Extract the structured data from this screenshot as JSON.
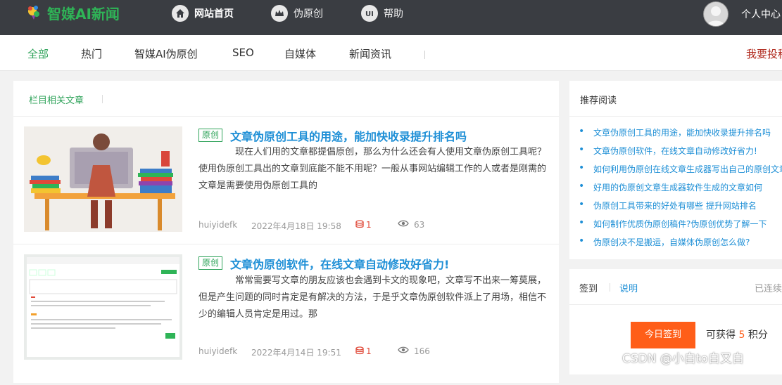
{
  "brand": {
    "name": "智媒AI新闻",
    "accent": "#2fb457"
  },
  "topnav": {
    "home": {
      "label": "网站首页",
      "icon": "home-icon"
    },
    "rewrite": {
      "label": "伪原创",
      "icon": "crown-icon"
    },
    "help": {
      "label": "帮助",
      "icon": "ui-icon"
    },
    "user": {
      "label": "个人中心"
    }
  },
  "categories": [
    "全部",
    "热门",
    "智媒AI伪原创",
    "SEO",
    "自媒体",
    "新闻资讯"
  ],
  "submit_link": "我要投稿",
  "main": {
    "heading": "栏目相关文章",
    "articles": [
      {
        "badge": "原创",
        "title": "文章伪原创工具的用途，能加快收录提升排名吗",
        "desc": "　　　　现在人们用的文章都提倡原创，那么为什么还会有人使用文章伪原创工具呢？使用伪原创工具出的文章到底能不能不用呢？一般从事网站编辑工作的人或者是刚需的文章是需要使用伪原创工具的",
        "author": "huiyidefk",
        "date": "2022年4月18日 19:58",
        "comments": "1",
        "views": "63"
      },
      {
        "badge": "原创",
        "title": "文章伪原创软件，在线文章自动修改好省力!",
        "desc": "　　　　常常需要写文章的朋友应该也会遇到卡文的现象吧，文章写不出来一筹莫展，但是产生问题的同时肯定是有解决的方法，于是乎文章伪原创软件派上了用场，相信不少的编辑人员肯定是用过。那",
        "author": "huiyidefk",
        "date": "2022年4月14日 19:51",
        "comments": "1",
        "views": "166"
      }
    ]
  },
  "sidebar": {
    "recommend_title": "推荐阅读",
    "recommend": [
      "文章伪原创工具的用途，能加快收录提升排名吗",
      "文章伪原创软件，在线文章自动修改好省力!",
      "如何利用伪原创在线文章生成器写出自己的原创文章",
      "好用的伪原创文章生成器软件生成的文章如何",
      "伪原创工具带来的好处有哪些 提升网站排名",
      "如何制作优质伪原创稿件?伪原创优势了解一下",
      "伪原创决不是搬运，自媒体伪原创怎么做?"
    ],
    "signin": {
      "label": "签到",
      "explain": "说明",
      "streak": "已连续签到",
      "button": "今日签到",
      "points_prefix": "可获得",
      "points_value": "5",
      "points_suffix": "积分"
    }
  },
  "watermark": "CSDN @小白to白又白"
}
